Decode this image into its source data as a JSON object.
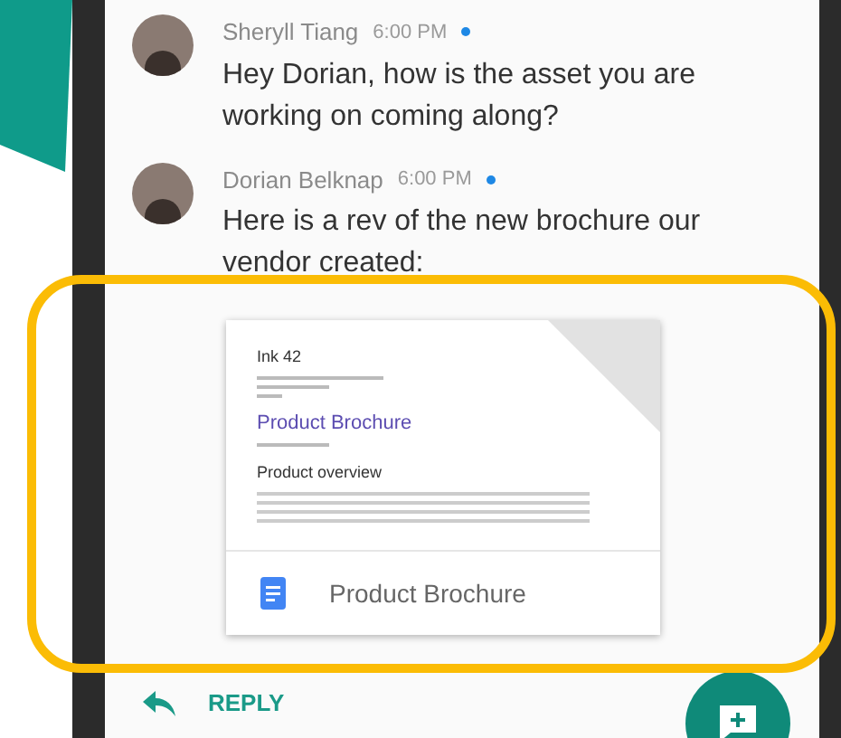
{
  "messages": [
    {
      "sender": "Sheryll Tiang",
      "time": "6:00 PM",
      "unread": true,
      "text": "Hey Dorian, how is the asset you are working on coming along?"
    },
    {
      "sender": "Dorian Belknap",
      "time": "6:00 PM",
      "unread": true,
      "text": "Here is a rev of the new brochure our vendor created:"
    }
  ],
  "attachment": {
    "preview": {
      "company": "Ink 42",
      "title": "Product Brochure",
      "section": "Product overview"
    },
    "file_name": "Product Brochure"
  },
  "reply_label": "REPLY"
}
